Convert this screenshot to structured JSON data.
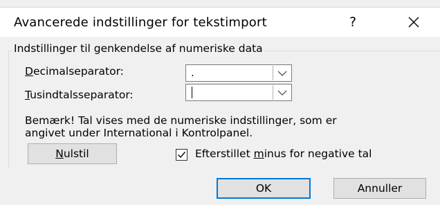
{
  "dialog": {
    "title": "Avancerede indstillinger for tekstimport",
    "help_label": "?",
    "close_icon": "close-icon"
  },
  "group": {
    "label": "Indstillinger til genkendelse af numeriske data"
  },
  "decimal": {
    "label_accel": "D",
    "label_rest": "ecimalseparator:",
    "value": "."
  },
  "thousands": {
    "label_accel": "T",
    "label_rest": "usindtalsseparator:",
    "value": ""
  },
  "note": {
    "line1": "Bemærk! Tal vises med de numeriske indstillinger, som er",
    "line2": "angivet under International i Kontrolpanel."
  },
  "reset": {
    "accel": "N",
    "rest": "ulstil"
  },
  "trailing_minus": {
    "checked": true,
    "label_before": "Efterstillet ",
    "label_accel": "m",
    "label_after": "inus for negative tal"
  },
  "buttons": {
    "ok": "OK",
    "cancel": "Annuller"
  }
}
